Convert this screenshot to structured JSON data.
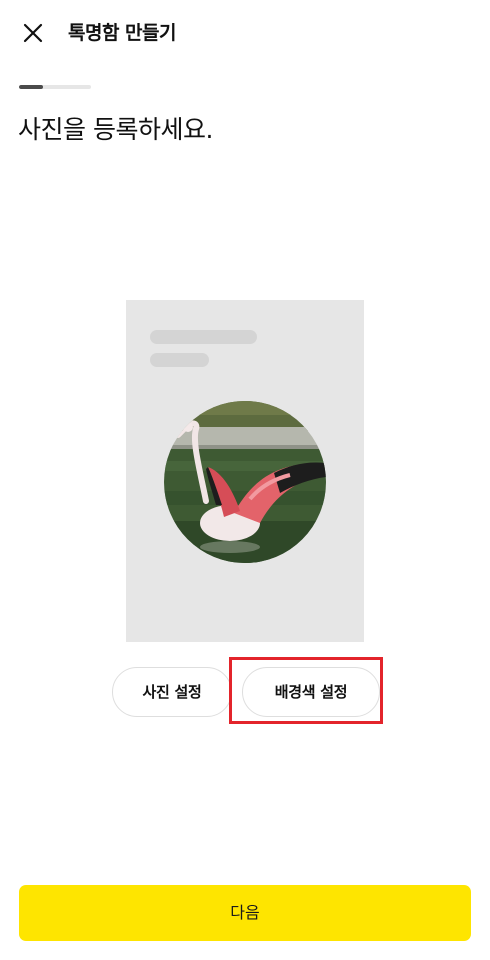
{
  "header": {
    "close_icon": "close-icon",
    "title": "톡명함 만들기"
  },
  "progress": {
    "fraction": 0.33
  },
  "main": {
    "headline": "사진을 등록하세요.",
    "preview_image": "flamingo-photo"
  },
  "actions": {
    "photo_settings_label": "사진 설정",
    "background_color_label": "배경색 설정"
  },
  "footer": {
    "next_label": "다음"
  },
  "colors": {
    "primary": "#fee500",
    "highlight_box": "#e3242b",
    "card_bg": "#e6e6e6"
  }
}
